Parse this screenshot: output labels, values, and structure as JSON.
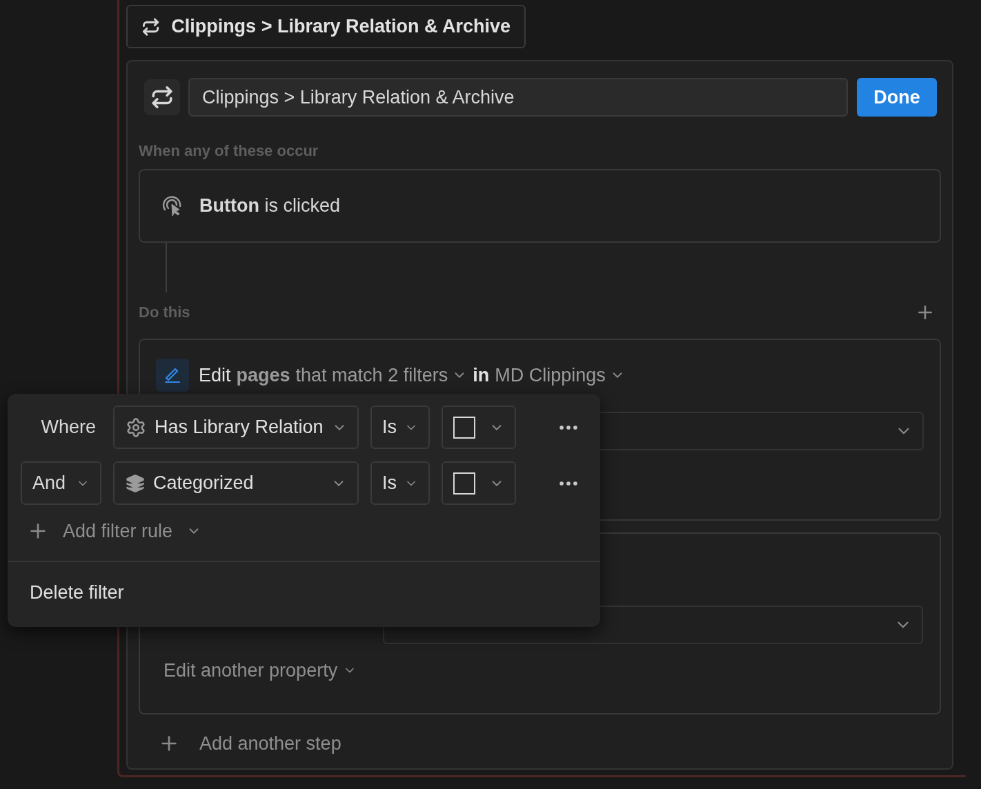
{
  "automation_title": {
    "title": "Clippings > Library Relation & Archive"
  },
  "editor": {
    "name_value": "Clippings > Library Relation & Archive",
    "done_button": "Done"
  },
  "trigger_section": {
    "label": "When any of these occur",
    "triggers": [
      {
        "text": "**Button** is clicked"
      }
    ]
  },
  "action_section": {
    "label": "Do this",
    "steps": [
      {
        "verb": "Edit",
        "target": "pages",
        "filter_summary": "that match 2 filters",
        "connector": "in",
        "database": "MD Clippings"
      },
      {
        "more_label": "Edit another property"
      }
    ],
    "add_step": "Add another step"
  },
  "filter_popup": {
    "rules": [
      {
        "conjunction": {
          "kind": "label",
          "text": "Where"
        },
        "property": {
          "kind": "computed",
          "name": "Has Library Relation"
        },
        "operator": "Is",
        "checked": false
      },
      {
        "conjunction": {
          "kind": "dropdown",
          "text": "And"
        },
        "property": {
          "kind": "basic",
          "name": "Categorized"
        },
        "operator": "Is",
        "checked": false
      }
    ],
    "add_rule": "Add filter rule",
    "delete": "Delete filter"
  }
}
